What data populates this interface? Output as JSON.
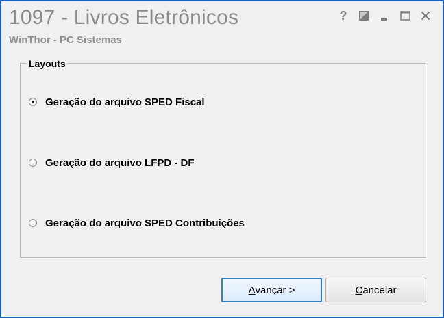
{
  "window": {
    "title": "1097 - Livros Eletrônicos",
    "subtitle": "WinThor - PC Sistemas",
    "controls": {
      "help": "?"
    }
  },
  "group": {
    "legend": "Layouts",
    "options": [
      {
        "label": "Geração do arquivo SPED Fiscal",
        "checked": true
      },
      {
        "label": "Geração do arquivo LFPD - DF",
        "checked": false
      },
      {
        "label": "Geração do arquivo SPED Contribuições",
        "checked": false
      }
    ]
  },
  "buttons": {
    "next_hotkey": "A",
    "next_rest": "vançar >",
    "cancel_hotkey": "C",
    "cancel_rest": "ancelar"
  },
  "colors": {
    "window_border": "#1c5fb5",
    "background": "#f0f0f0",
    "title_text": "#8a8a8a",
    "primary_button_border": "#3c7fb1"
  }
}
